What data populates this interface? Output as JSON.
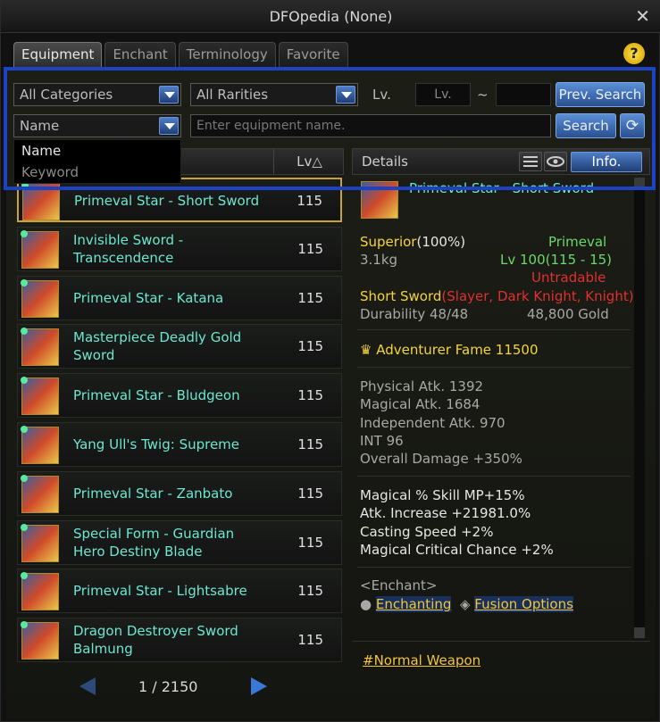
{
  "window": {
    "title": "DFOpedia (None)",
    "close_glyph": "✕"
  },
  "tabs": [
    {
      "label": "Equipment",
      "active": true
    },
    {
      "label": "Enchant",
      "active": false
    },
    {
      "label": "Terminology",
      "active": false
    },
    {
      "label": "Favorite",
      "active": false
    }
  ],
  "help_glyph": "?",
  "filters": {
    "category": "All Categories",
    "rarity": "All Rarities",
    "lv_label": "Lv.",
    "lv_min_placeholder": "Lv.",
    "lv_max_placeholder": "",
    "tilde": "~",
    "prev_search_label": "Prev. Search",
    "search_type": "Name",
    "search_placeholder": "Enter equipment name.",
    "search_label": "Search",
    "refresh_glyph": "⟳"
  },
  "search_type_menu": [
    "Name",
    "Keyword"
  ],
  "list": {
    "lv_column": "Lv△",
    "items": [
      {
        "name": "Primeval Star - Short Sword",
        "lv": "115",
        "selected": true
      },
      {
        "name": "Invisible Sword - Transcendence",
        "lv": "115",
        "selected": false
      },
      {
        "name": "Primeval Star - Katana",
        "lv": "115",
        "selected": false
      },
      {
        "name": "Masterpiece Deadly Gold Sword",
        "lv": "115",
        "selected": false
      },
      {
        "name": "Primeval Star - Bludgeon",
        "lv": "115",
        "selected": false
      },
      {
        "name": "Yang Ull's Twig: Supreme",
        "lv": "115",
        "selected": false
      },
      {
        "name": "Primeval Star - Zanbato",
        "lv": "115",
        "selected": false
      },
      {
        "name": "Special Form - Guardian Hero Destiny Blade",
        "lv": "115",
        "selected": false
      },
      {
        "name": "Primeval Star - Lightsabre",
        "lv": "115",
        "selected": false
      },
      {
        "name": "Dragon Destroyer Sword Balmung",
        "lv": "115",
        "selected": false
      }
    ],
    "page": "1 / 2150"
  },
  "details": {
    "header_label": "Details",
    "info_label": "Info.",
    "item_name": "Primeval Star - Short Sword",
    "grade_word": "Superior",
    "grade_pct": "(100%)",
    "rarity": "Primeval",
    "weight": "3.1kg",
    "level_req": "Lv 100(115 - 15)",
    "tradable": "Untradable",
    "weapon_type": "Short Sword",
    "classes": "(Slayer, Dark Knight, Knight)",
    "durability": "Durability 48/48",
    "price": "48,800 Gold",
    "fame": "Adventurer Fame 11500",
    "stats": [
      "Physical Atk. 1392",
      "Magical Atk. 1684",
      "Independent Atk. 970",
      "INT 96",
      "Overall Damage +350%"
    ],
    "effects": [
      "Magical % Skill MP+15%",
      "Atk. Increase +21981.0%",
      "Casting Speed +2%",
      "Magical Critical Chance +2%"
    ],
    "enchant_header": "<Enchant>",
    "enchanting_link": "Enchanting",
    "fusion_link": "Fusion Options",
    "footer_link": "#Normal Weapon"
  },
  "colors": {
    "accent_blue": "#1d43c4",
    "item_name": "#6be8d0",
    "gold": "#f5d43a",
    "red": "#e03030",
    "green": "#6bd86b"
  }
}
